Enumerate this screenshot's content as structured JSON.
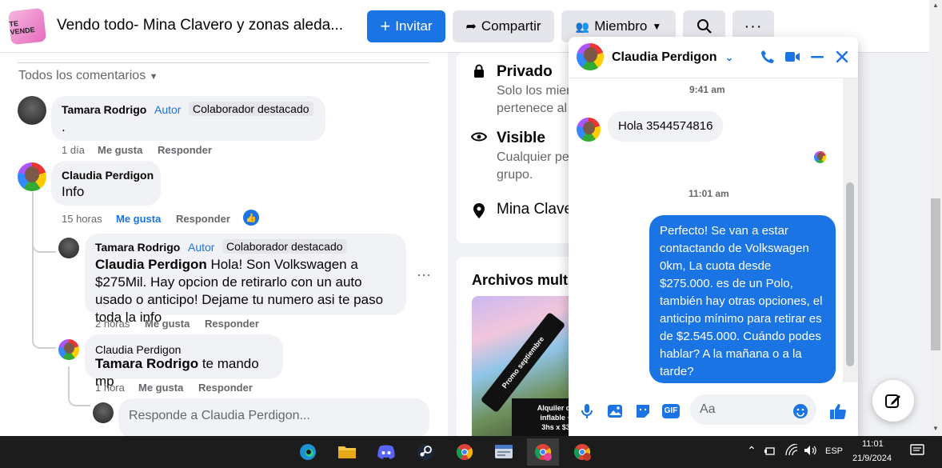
{
  "group": {
    "title": "Vendo todo- Mina Clavero y zonas aleda...",
    "thumb_text": "TE VENDE"
  },
  "header_buttons": {
    "invite": "Invitar",
    "share": "Compartir",
    "member": "Miembro"
  },
  "comments": {
    "sort_label": "Todos los comentarios",
    "items": [
      {
        "name": "Tamara Rodrigo",
        "author": "Autor",
        "badge": "Colaborador destacado",
        "text": ".",
        "time": "1 día",
        "like": "Me gusta",
        "reply": "Responder"
      },
      {
        "name": "Claudia Perdigon",
        "text": "Info",
        "time": "15 horas",
        "like": "Me gusta",
        "reply": "Responder"
      },
      {
        "name": "Tamara Rodrigo",
        "author": "Autor",
        "badge": "Colaborador destacado",
        "mention": "Claudia Perdigon",
        "text": "Hola! Son Volkswagen a $275Mil. Hay opcion de retirarlo con un auto usado o anticipo! Dejame tu numero asi te paso toda la info",
        "time": "2 horas",
        "like": "Me gusta",
        "reply": "Responder"
      },
      {
        "name": "Claudia Perdigon",
        "mention": "Tamara Rodrigo",
        "text": "te mando mp",
        "time": "1 hora",
        "like": "Me gusta",
        "reply": "Responder"
      }
    ],
    "reply_placeholder": "Responde a Claudia Perdigon..."
  },
  "about": {
    "private_title": "Privado",
    "private_desc_1": "Solo los mier",
    "private_desc_2": "pertenece al",
    "visible_title": "Visible",
    "visible_desc_1": "Cualquier pe",
    "visible_desc_2": "grupo.",
    "location": "Mina Clave"
  },
  "media": {
    "title": "Archivos multi",
    "image_caption": "Promo septiembre",
    "image_text_1": "Alquiler de",
    "image_text_2": "inflable +",
    "image_text_3": "3hs x $3"
  },
  "chat": {
    "contact": "Claudia Perdigon",
    "time_1": "9:41 am",
    "incoming": "Hola 3544574816",
    "time_2": "11:01 am",
    "outgoing": "Perfecto!  Se van a estar contactando de Volkswagen 0km, La cuota desde $275.000. es de un Polo, también hay otras opciones, el anticipo mínimo para retirar es de $2.545.000. Cuándo podes hablar? A la mañana o a la tarde?",
    "composer_placeholder": "Aa"
  },
  "taskbar": {
    "language": "ESP",
    "time": "11:01",
    "date": "21/9/2024"
  },
  "colors": {
    "accent": "#1b74e4",
    "bubble_gray": "#f0f2f5",
    "taskbar": "#1c1c1c"
  }
}
